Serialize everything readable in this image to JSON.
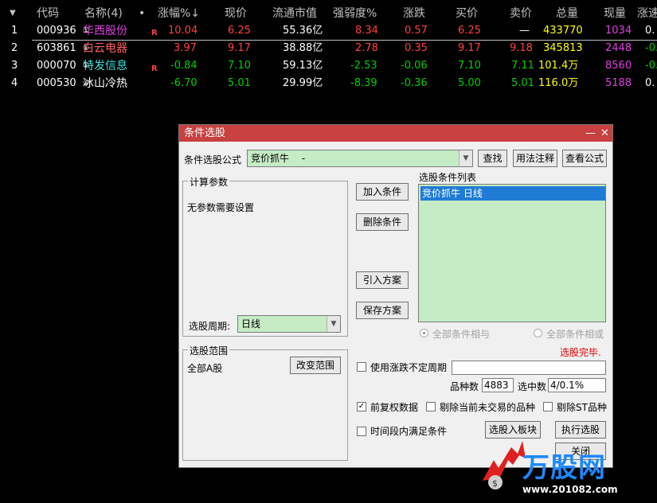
{
  "table": {
    "headers": {
      "code": "代码",
      "name": "名称(4)",
      "dot": "•",
      "change_pct": "涨幅%↓",
      "price": "现价",
      "float_mv": "流通市值",
      "strength": "强弱度%",
      "change": "涨跌",
      "bid": "买价",
      "ask": "卖价",
      "volume": "总量",
      "cur_vol": "现量",
      "speed": "涨速"
    },
    "rows": [
      {
        "idx": "1",
        "code": "000936",
        "name": "华西股份",
        "sup": "①",
        "r": "R",
        "change_pct": "10.04",
        "price": "6.25",
        "float_mv": "55.36亿",
        "strength": "8.34",
        "change": "0.57",
        "bid": "6.25",
        "ask": "—",
        "volume": "433770",
        "cur_vol": "1034",
        "speed": "0."
      },
      {
        "idx": "2",
        "code": "603861",
        "name": "白云电器",
        "sup": "①",
        "r": "",
        "change_pct": "3.97",
        "price": "9.17",
        "float_mv": "38.88亿",
        "strength": "2.78",
        "change": "0.35",
        "bid": "9.17",
        "ask": "9.18",
        "volume": "345813",
        "cur_vol": "2448",
        "speed": "-0."
      },
      {
        "idx": "3",
        "code": "000070",
        "name": "特发信息",
        "sup": "①",
        "r": "R",
        "change_pct": "-0.84",
        "price": "7.10",
        "float_mv": "59.13亿",
        "strength": "-2.53",
        "change": "-0.06",
        "bid": "7.10",
        "ask": "7.11",
        "volume": "101.4万",
        "cur_vol": "8560",
        "speed": "-0."
      },
      {
        "idx": "4",
        "code": "000530",
        "name": "冰山冷热",
        "sup": "①",
        "r": "",
        "change_pct": "-6.70",
        "price": "5.01",
        "float_mv": "29.99亿",
        "strength": "-8.39",
        "change": "-0.36",
        "bid": "5.00",
        "ask": "5.01",
        "volume": "116.0万",
        "cur_vol": "5188",
        "speed": "0."
      }
    ]
  },
  "dialog": {
    "title": "条件选股",
    "min": "—",
    "close": "✕",
    "formula_label": "条件选股公式",
    "formula_value": "竞价抓牛　 -",
    "find_btn": "查找",
    "usage_btn": "用法注释",
    "view_btn": "查看公式",
    "params_group": "计算参数",
    "no_params": "无参数需要设置",
    "period_label": "选股周期:",
    "period_value": "日线",
    "add_btn": "加入条件",
    "del_btn": "删除条件",
    "import_btn": "引入方案",
    "save_btn": "保存方案",
    "cond_list_label": "选股条件列表",
    "cond_item": "竞价抓牛  日线",
    "radio_and": "全部条件相与",
    "radio_or": "全部条件相或",
    "status": "选股完毕.",
    "scope_group": "选股范围",
    "scope_value": "全部A股",
    "change_scope_btn": "改变范围",
    "uncertain_period": "使用涨跌不定周期",
    "count_label": "品种数",
    "count_value": "4883",
    "selected_label": "选中数",
    "selected_value": "4/0.1%",
    "adjusted": "前复权数据",
    "exclude_untraded": "剔除当前未交易的品种",
    "exclude_st": "剔除ST品种",
    "time_cond": "时间段内满足条件",
    "to_board_btn": "选股入板块",
    "run_btn": "执行选股",
    "close_btn": "关闭"
  },
  "logo": {
    "text": "万股网",
    "url": "www.201082.com"
  },
  "colors": {
    "up": "#ff4040",
    "down": "#00d000",
    "neutral": "#ffffff",
    "yellow": "#ffff00",
    "title_bar": "#c84040"
  }
}
